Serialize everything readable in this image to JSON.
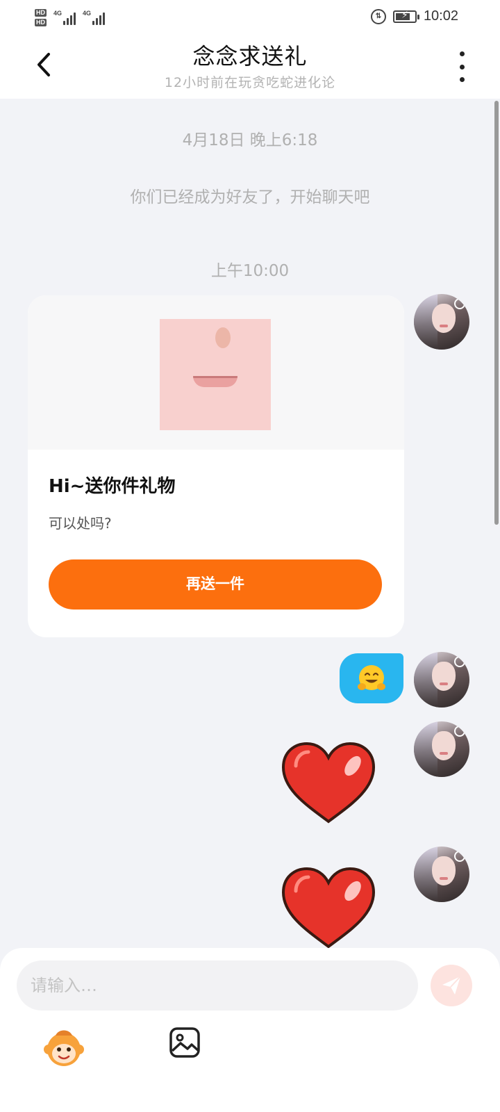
{
  "status_bar": {
    "hd_badges": [
      "HD",
      "HD"
    ],
    "network_labels": [
      "4G",
      "4G"
    ],
    "time": "10:02"
  },
  "header": {
    "title": "念念求送礼",
    "subtitle": "12小时前在玩贪吃蛇进化论"
  },
  "messages": {
    "timestamp_1": "4月18日 晚上6:18",
    "friend_note": "你们已经成为好友了，开始聊天吧",
    "timestamp_2": "上午10:00",
    "gift_card": {
      "title": "Hi~送你件礼物",
      "subtitle": "可以处吗?",
      "button_label": "再送一件"
    },
    "emoji_bubble": "hugging-face-emoji",
    "stickers": [
      "heart-sticker",
      "heart-sticker"
    ]
  },
  "composer": {
    "placeholder": "请输入…",
    "tools": [
      "monkey-emoji-icon",
      "gallery-icon"
    ]
  },
  "colors": {
    "accent_orange": "#fc6f0e",
    "bubble_blue": "#29b6ef",
    "background": "#f2f3f7"
  }
}
